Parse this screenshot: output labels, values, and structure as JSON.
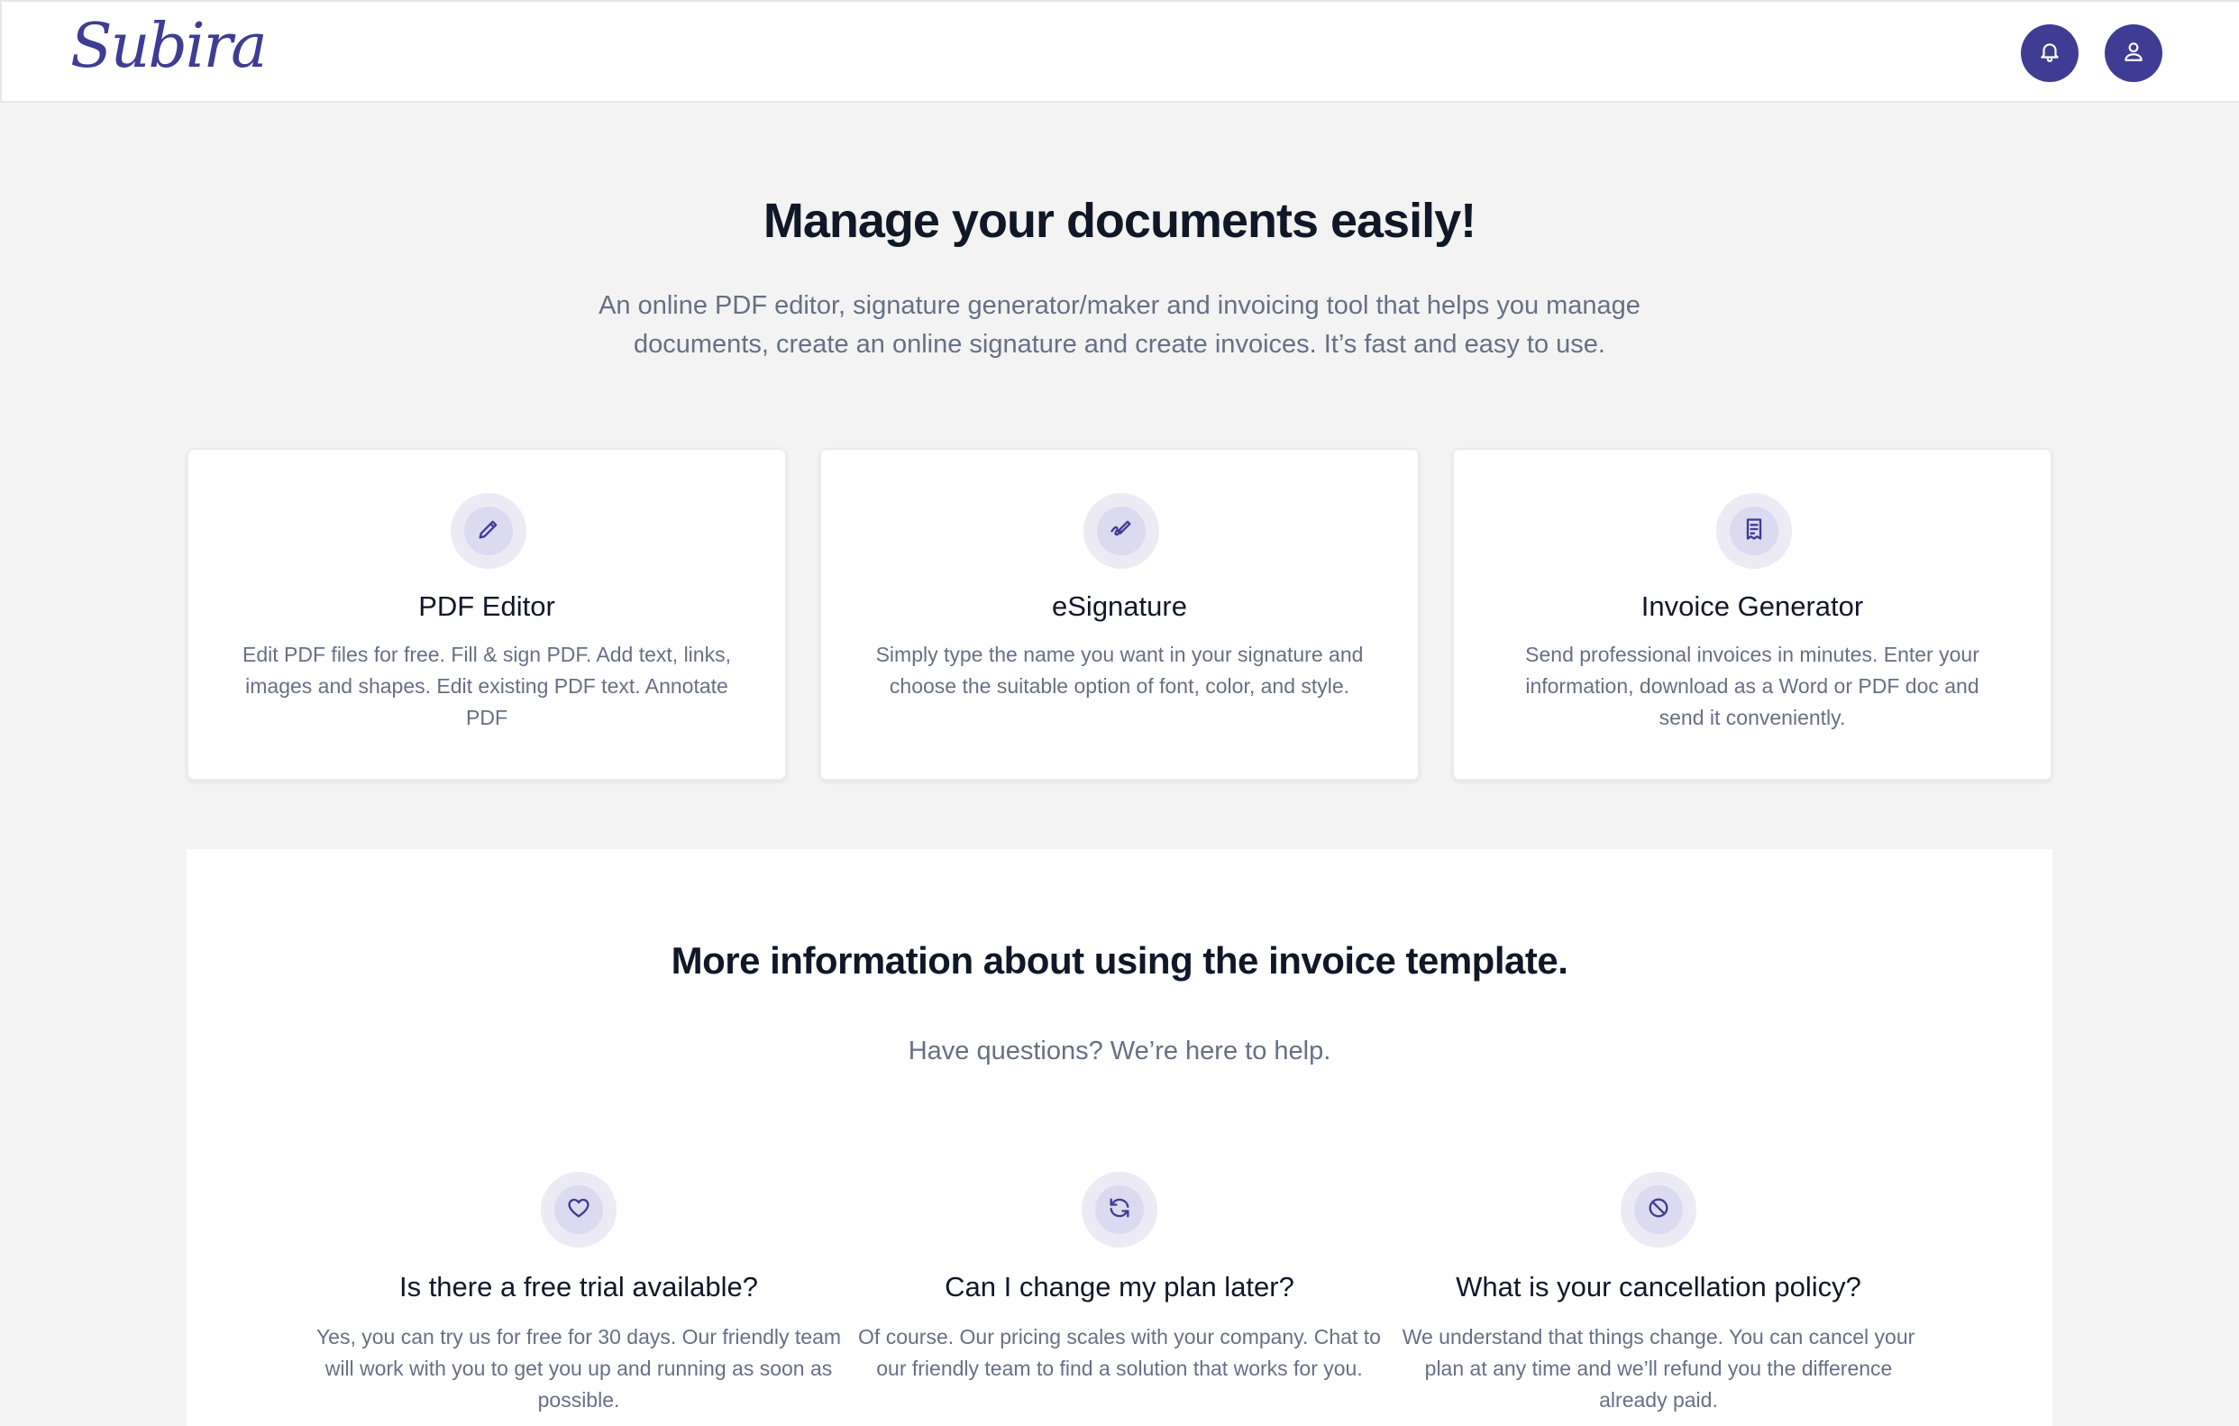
{
  "header": {
    "logo_text": "Subira",
    "brand_color": "#3f3c94",
    "icons": [
      "bell-icon",
      "user-icon"
    ]
  },
  "hero": {
    "title": "Manage your documents easily!",
    "subtitle": "An online PDF editor, signature generator/maker and invoicing tool that helps you manage documents, create an online signature and create invoices. It’s fast and easy to use."
  },
  "features": [
    {
      "icon": "pencil-icon",
      "title": "PDF Editor",
      "description": "Edit PDF files for free. Fill & sign PDF. Add text, links, images and shapes. Edit existing PDF text. Annotate PDF"
    },
    {
      "icon": "signature-icon",
      "title": "eSignature",
      "description": "Simply type the name you want in your signature and choose the suitable option of font, color, and style."
    },
    {
      "icon": "receipt-icon",
      "title": "Invoice Generator",
      "description": "Send professional invoices in minutes. Enter your information, download as a Word or PDF doc and send it conveniently."
    }
  ],
  "info": {
    "title": "More information about using the invoice template.",
    "subtitle": "Have questions? We’re here to help.",
    "faqs": [
      {
        "icon": "heart-icon",
        "question": "Is there a free trial available?",
        "answer": "Yes, you can try us for free for 30 days. Our friendly team will work with you to get you up and running as soon as possible."
      },
      {
        "icon": "refresh-icon",
        "question": "Can I change my plan later?",
        "answer": "Of course. Our pricing scales with your company. Chat to our friendly team to find a solution that works for you."
      },
      {
        "icon": "ban-icon",
        "question": "What is your cancellation policy?",
        "answer": "We understand that things change. You can cancel your plan at any time and we’ll refund you the difference already paid."
      }
    ]
  }
}
